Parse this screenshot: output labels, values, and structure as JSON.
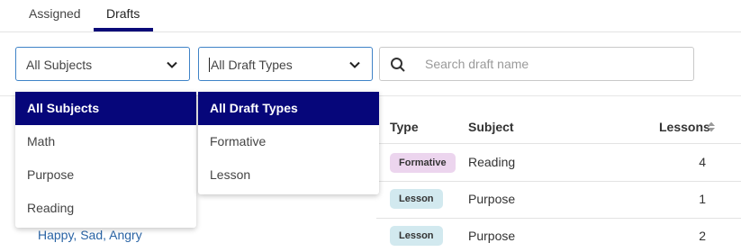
{
  "tabs": [
    {
      "label": "Assigned"
    },
    {
      "label": "Drafts"
    }
  ],
  "filters": {
    "subject_value": "All Subjects",
    "type_value": "All Draft Types",
    "search_placeholder": "Search draft name"
  },
  "subject_menu": [
    "All Subjects",
    "Math",
    "Purpose",
    "Reading"
  ],
  "type_menu": [
    "All Draft Types",
    "Formative",
    "Lesson"
  ],
  "table": {
    "headers": {
      "type": "Type",
      "subject": "Subject",
      "lessons": "Lessons"
    },
    "rows": [
      {
        "name": "",
        "type": "Formative",
        "subject": "Reading",
        "lessons": "4"
      },
      {
        "name": "",
        "type": "Lesson",
        "subject": "Purpose",
        "lessons": "1"
      },
      {
        "name": "Happy, Sad, Angry",
        "type": "Lesson",
        "subject": "Purpose",
        "lessons": "2"
      }
    ]
  },
  "colors": {
    "accent": "#0a0a78",
    "select_border": "#3f83c7",
    "badge_formative": "#ecd5ee",
    "badge_lesson": "#d2e9ef",
    "link": "#2a64a5"
  },
  "icons": {
    "select_chevron": "chevron-down-icon",
    "search": "search-icon",
    "sort": "sort-icon"
  }
}
